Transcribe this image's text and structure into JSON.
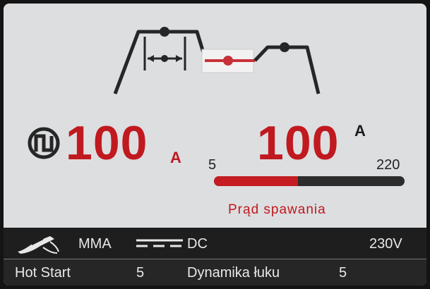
{
  "process": {
    "preset_value": "100",
    "preset_unit": "A",
    "display_value": "100",
    "display_unit": "A",
    "range_min": "5",
    "range_max": "220",
    "level_fraction": 0.44,
    "parameter_name": "Prąd spawania"
  },
  "status_bar": {
    "mode": "MMA",
    "current_type": "DC",
    "voltage": "230V"
  },
  "info_bar": {
    "hot_start_label": "Hot Start",
    "hot_start_value": "5",
    "arc_force_label": "Dynamika łuku",
    "arc_force_value": "5"
  },
  "icons": {
    "mode_icon": "pulse-circle-icon",
    "electrode_icon": "electrode-holder-icon",
    "dc_icon": "dc-symbol-icon"
  },
  "colors": {
    "accent": "#c0191f",
    "screen_bg": "#dcdee0",
    "bar_bg": "#1e1e1e"
  }
}
